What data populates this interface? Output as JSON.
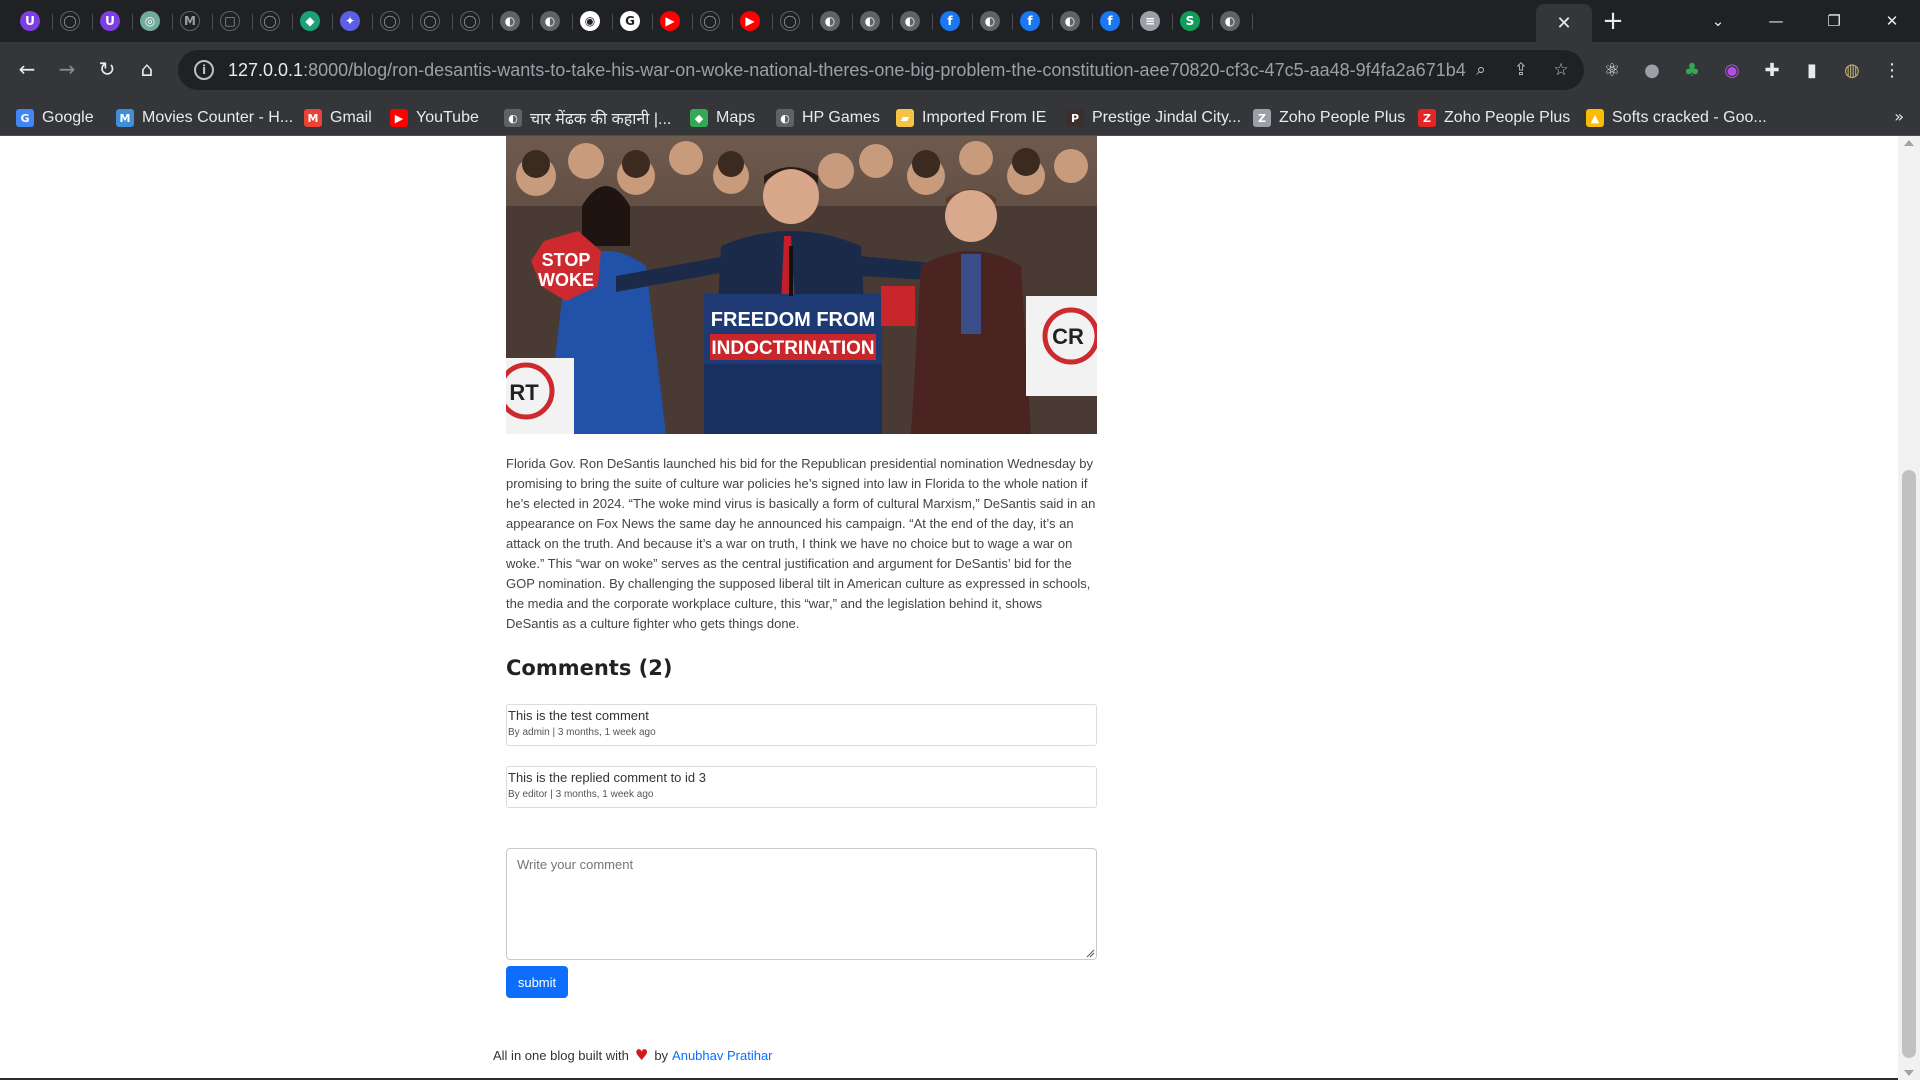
{
  "browser": {
    "active_tab_close": "✕",
    "new_tab": "+",
    "tab_search": "⌄",
    "window": {
      "minimize": "—",
      "restore": "❐",
      "close": "✕"
    },
    "favicons": [
      {
        "name": "tab-proton-icon",
        "glyph": "U",
        "color": "#7b3fe4"
      },
      {
        "name": "tab-github-icon",
        "glyph": "◯",
        "color": "#202124"
      },
      {
        "name": "tab-proton-icon",
        "glyph": "U",
        "color": "#7b3fe4"
      },
      {
        "name": "tab-chatgpt-icon",
        "glyph": "◎",
        "color": "#74aa9c"
      },
      {
        "name": "tab-gmail-icon",
        "glyph": "M",
        "color": "#202124"
      },
      {
        "name": "tab-square-icon",
        "glyph": "□",
        "color": "#202124"
      },
      {
        "name": "tab-github-icon",
        "glyph": "◯",
        "color": "#202124"
      },
      {
        "name": "tab-arrow-icon",
        "glyph": "◆",
        "color": "#1aa179"
      },
      {
        "name": "tab-gemini-icon",
        "glyph": "✦",
        "color": "#5b5fe8"
      },
      {
        "name": "tab-github-icon",
        "glyph": "◯",
        "color": "#202124"
      },
      {
        "name": "tab-github-icon",
        "glyph": "◯",
        "color": "#202124"
      },
      {
        "name": "tab-github-icon",
        "glyph": "◯",
        "color": "#202124"
      },
      {
        "name": "tab-globe-icon",
        "glyph": "◐",
        "color": "#5f6368"
      },
      {
        "name": "tab-globe-icon",
        "glyph": "◐",
        "color": "#5f6368"
      },
      {
        "name": "tab-chrome-icon",
        "glyph": "◉",
        "color": "#ffffff"
      },
      {
        "name": "tab-google-icon",
        "glyph": "G",
        "color": "#ffffff"
      },
      {
        "name": "tab-youtube-icon",
        "glyph": "▶",
        "color": "#ff0000"
      },
      {
        "name": "tab-github-icon",
        "glyph": "◯",
        "color": "#202124"
      },
      {
        "name": "tab-youtube-icon",
        "glyph": "▶",
        "color": "#ff0000"
      },
      {
        "name": "tab-github-icon",
        "glyph": "◯",
        "color": "#202124"
      },
      {
        "name": "tab-globe-icon",
        "glyph": "◐",
        "color": "#5f6368"
      },
      {
        "name": "tab-globe-icon",
        "glyph": "◐",
        "color": "#5f6368"
      },
      {
        "name": "tab-globe-icon",
        "glyph": "◐",
        "color": "#5f6368"
      },
      {
        "name": "tab-facebook-icon",
        "glyph": "f",
        "color": "#1877f2"
      },
      {
        "name": "tab-globe-icon",
        "glyph": "◐",
        "color": "#5f6368"
      },
      {
        "name": "tab-facebook-icon",
        "glyph": "f",
        "color": "#1877f2"
      },
      {
        "name": "tab-globe-icon",
        "glyph": "◐",
        "color": "#5f6368"
      },
      {
        "name": "tab-facebook-icon",
        "glyph": "f",
        "color": "#1877f2"
      },
      {
        "name": "tab-database-icon",
        "glyph": "≡",
        "color": "#9aa0a6"
      },
      {
        "name": "tab-layers-icon",
        "glyph": "S",
        "color": "#0f9d58"
      },
      {
        "name": "tab-globe-icon",
        "glyph": "◐",
        "color": "#5f6368"
      }
    ]
  },
  "toolbar": {
    "back": "←",
    "forward": "→",
    "reload": "↻",
    "home": "⌂",
    "url_host": "127.0.0.1",
    "url_path": ":8000/blog/ron-desantis-wants-to-take-his-war-on-woke-national-theres-one-big-problem-the-constitution-aee70820-cf3c-47c5-aa48-9f4fa2a671b4",
    "zoom": "⌕",
    "share": "⇪",
    "star": "☆",
    "extensions": [
      "⚛",
      "●",
      "♣",
      "◉",
      "✚",
      "▮",
      "◍",
      "⋮"
    ]
  },
  "bookmarks": [
    {
      "label": "Google",
      "glyph": "G",
      "color": "#4285f4"
    },
    {
      "label": "Movies Counter - H...",
      "glyph": "M",
      "color": "#3f8ed8"
    },
    {
      "label": "Gmail",
      "glyph": "M",
      "color": "#ea4335"
    },
    {
      "label": "YouTube",
      "glyph": "▶",
      "color": "#ff0000"
    },
    {
      "label": "चार मेंढक की कहानी |...",
      "glyph": "◐",
      "color": "#5f6368"
    },
    {
      "label": "Maps",
      "glyph": "◆",
      "color": "#34a853"
    },
    {
      "label": "HP Games",
      "glyph": "◐",
      "color": "#5f6368"
    },
    {
      "label": "Imported From IE",
      "glyph": "▰",
      "color": "#f6c344"
    },
    {
      "label": "Prestige Jindal City...",
      "glyph": "P",
      "color": "#3a2f2a"
    },
    {
      "label": "Zoho People Plus",
      "glyph": "Z",
      "color": "#9aa0a6"
    },
    {
      "label": "Zoho People Plus",
      "glyph": "Z",
      "color": "#e42527"
    },
    {
      "label": "Softs cracked - Goo...",
      "glyph": "▲",
      "color": "#fbbc04"
    }
  ],
  "bookmarks_more": "»",
  "hero": {
    "podium_line1": "FREEDOM FROM",
    "podium_line2": "INDOCTRINATION",
    "sign_stop": "STOP",
    "sign_woke": "WOKE",
    "sign_crt": "RT",
    "sign_crt2": "CR"
  },
  "article": {
    "body": "Florida Gov. Ron DeSantis launched his bid for the Republican presidential nomination Wednesday by promising to bring the suite of culture war policies he’s signed into law in Florida to the whole nation if he’s elected in 2024. “The woke mind virus is basically a form of cultural Marxism,” DeSantis said in an appearance on Fox News the same day he announced his campaign. “At the end of the day, it’s an attack on the truth. And because it’s a war on truth, I think we have no choice but to wage a war on woke.” This “war on woke” serves as the central justification and argument for DeSantis’ bid for the GOP nomination. By challenging the supposed liberal tilt in American culture as expressed in schools, the media and the corporate workplace culture, this “war,” and the legislation behind it, shows DeSantis as a culture fighter who gets things done."
  },
  "comments": {
    "title": "Comments (2)",
    "items": [
      {
        "text": "This is the test comment",
        "meta": "By admin | 3 months, 1 week ago"
      },
      {
        "text": "This is the replied comment to id 3",
        "meta": "By editor | 3 months, 1 week ago"
      }
    ],
    "placeholder": "Write your comment",
    "submit_label": "submit"
  },
  "footer": {
    "text": "All in one blog built with",
    "by": "by",
    "author": "Anubhav Pratihar",
    "heart_color": "#d11a1a"
  }
}
